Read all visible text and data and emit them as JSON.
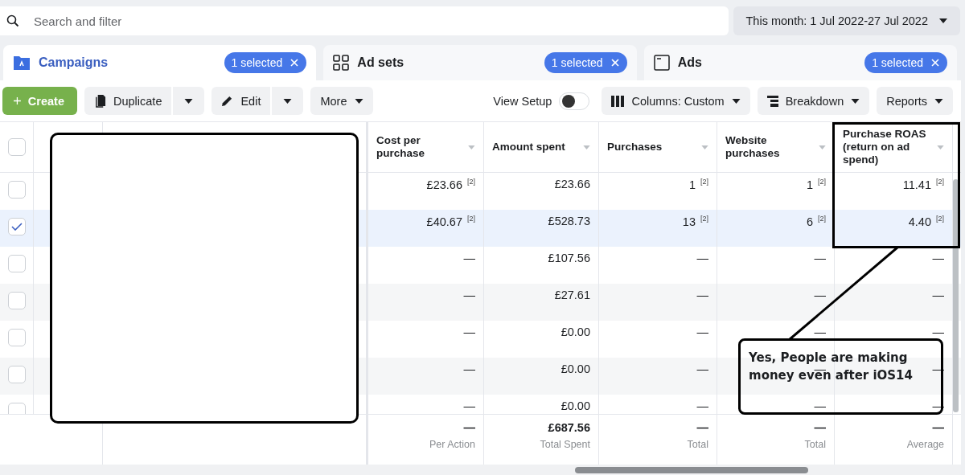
{
  "search": {
    "placeholder": "Search and filter"
  },
  "date_range": {
    "label": "This month: 1 Jul 2022-27 Jul 2022"
  },
  "tabs": [
    {
      "label": "Campaigns",
      "kind": "campaigns",
      "selected": true,
      "badge": "1 selected"
    },
    {
      "label": "Ad sets",
      "kind": "adsets",
      "selected": false,
      "badge": "1 selected"
    },
    {
      "label": "Ads",
      "kind": "ads",
      "selected": false,
      "badge": "1 selected"
    }
  ],
  "toolbar": {
    "create": "Create",
    "duplicate": "Duplicate",
    "edit": "Edit",
    "more": "More",
    "view_setup": {
      "label": "View Setup",
      "on": false
    },
    "columns": "Columns: Custom",
    "breakdown": "Breakdown",
    "reports": "Reports"
  },
  "table": {
    "select_all": {
      "checked": false
    },
    "columns": [
      "Cost per purchase",
      "Amount spent",
      "Purchases",
      "Website purchases",
      "Purchase ROAS (return on ad spend)"
    ],
    "rows": [
      {
        "selected": false,
        "cells": [
          "£23.66 $^{[2]}$",
          "£23.66",
          "1 $^{[2]}$",
          "1 $^{[2]}$",
          "11.41 $^{[2]}$"
        ]
      },
      {
        "selected": true,
        "cells": [
          "£40.67 $^{[2]}$",
          "£528.73",
          "13 $^{[2]}$",
          "6 $^{[2]}$",
          "4.40 $^{[2]}$"
        ]
      },
      {
        "selected": false,
        "cells": [
          "—",
          "£107.56",
          "—",
          "—",
          "—"
        ]
      },
      {
        "selected": false,
        "cells": [
          "—",
          "£27.61",
          "—",
          "—",
          "—"
        ]
      },
      {
        "selected": false,
        "cells": [
          "—",
          "£0.00",
          "—",
          "—",
          "—"
        ]
      },
      {
        "selected": false,
        "cells": [
          "—",
          "£0.00",
          "—",
          "—",
          "—"
        ]
      },
      {
        "selected": false,
        "cells": [
          "—",
          "£0.00",
          "—",
          "—",
          "—"
        ]
      }
    ],
    "footer": [
      {
        "value": "—",
        "label": "Per Action"
      },
      {
        "value": "£687.56",
        "label": "Total Spent"
      },
      {
        "value": "—",
        "label": "Total"
      },
      {
        "value": "—",
        "label": "Total"
      },
      {
        "value": "—",
        "label": "Average"
      }
    ]
  },
  "annotation": {
    "text": "Yes, People are making money even after iOS14"
  }
}
